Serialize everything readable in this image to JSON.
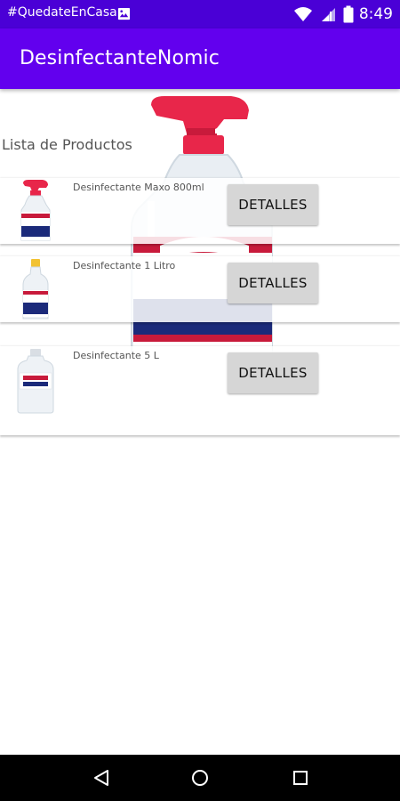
{
  "status_bar": {
    "notification_text": "#QuedateEnCasa",
    "notification_icon": "image-icon",
    "icons": [
      "wifi-icon",
      "signal-icon",
      "battery-icon"
    ],
    "time": "8:49"
  },
  "app_bar": {
    "title": "DesinfectanteNomic",
    "color": "#6200ee"
  },
  "main": {
    "heading": "Lista de Productos",
    "background_image": "spray-bottle-image",
    "products": [
      {
        "name": "Desinfectante Maxo 800ml",
        "button_label": "DETALLES",
        "thumbnail": "spray-bottle-image"
      },
      {
        "name": "Desinfectante 1 Litro",
        "button_label": "DETALLES",
        "thumbnail": "liter-bottle-image"
      },
      {
        "name": "Desinfectante 5 L",
        "button_label": "DETALLES",
        "thumbnail": "gallon-jug-image"
      }
    ]
  },
  "nav_bar": {
    "buttons": [
      "back-icon",
      "home-icon",
      "recents-icon"
    ]
  },
  "colors": {
    "status_bar": "#4a00d6",
    "app_bar": "#6200ee",
    "button": "#d6d6d6",
    "bottle_cap": "#e8264a",
    "label_blue": "#1b2a7a"
  }
}
